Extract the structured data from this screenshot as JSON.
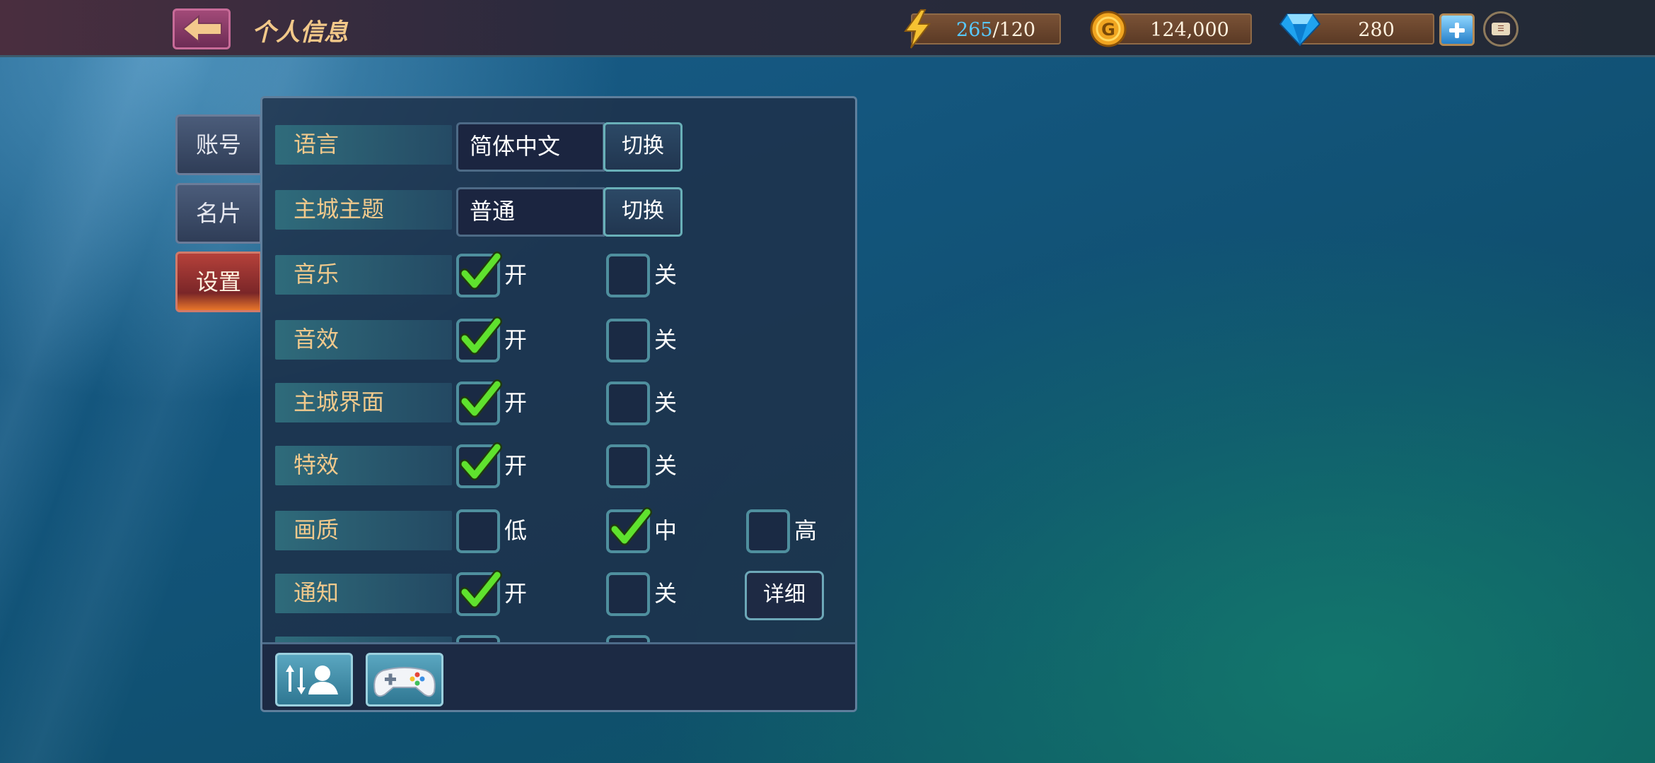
{
  "header": {
    "title": "个人信息",
    "energy": {
      "current": "265",
      "max": "/120"
    },
    "gold": "124,000",
    "gems": "280"
  },
  "tabs": [
    {
      "label": "账号",
      "active": false
    },
    {
      "label": "名片",
      "active": false
    },
    {
      "label": "设置",
      "active": true
    }
  ],
  "settings": {
    "language": {
      "label": "语言",
      "value": "简体中文",
      "button": "切换"
    },
    "theme": {
      "label": "主城主题",
      "value": "普通",
      "button": "切换"
    },
    "music": {
      "label": "音乐",
      "on": "开",
      "off": "关",
      "selected": "on"
    },
    "sfx": {
      "label": "音效",
      "on": "开",
      "off": "关",
      "selected": "on"
    },
    "city_ui": {
      "label": "主城界面",
      "on": "开",
      "off": "关",
      "selected": "on"
    },
    "effects": {
      "label": "特效",
      "on": "开",
      "off": "关",
      "selected": "on"
    },
    "quality": {
      "label": "画质",
      "low": "低",
      "mid": "中",
      "high": "高",
      "selected": "mid"
    },
    "notify": {
      "label": "通知",
      "on": "开",
      "off": "关",
      "selected": "on",
      "detail": "详细"
    }
  },
  "bottom_buttons": [
    "account-switch-icon",
    "gamepad-icon"
  ],
  "colors": {
    "accent_label": "#f0c98c",
    "check_green": "#5fe22e",
    "energy_blue": "#57c9ff"
  }
}
